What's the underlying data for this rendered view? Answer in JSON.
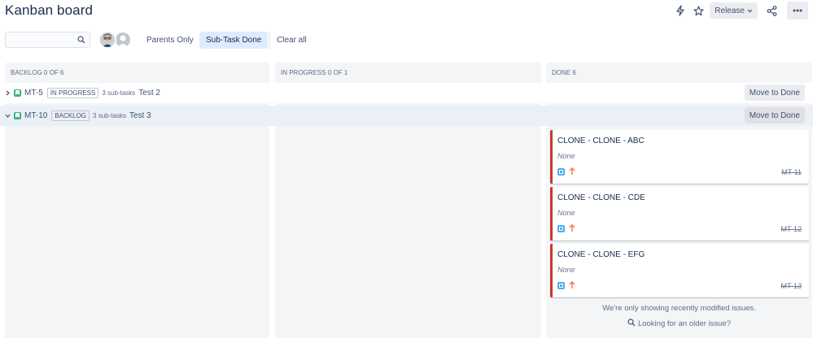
{
  "header": {
    "title": "Kanban board",
    "release_label": "Release",
    "icons": [
      "lightning-icon",
      "star-icon",
      "chevron-down-icon",
      "share-icon",
      "more-icon"
    ]
  },
  "filters": {
    "search_placeholder": "",
    "parents_only": "Parents Only",
    "subtask_done": "Sub-Task Done",
    "clear_all": "Clear all"
  },
  "columns": [
    {
      "name": "BACKLOG",
      "count": "0 of 6"
    },
    {
      "name": "IN PROGRESS",
      "count": "0 of 1"
    },
    {
      "name": "DONE",
      "count": "6"
    }
  ],
  "swimlanes": [
    {
      "key": "MT-5",
      "status": "IN PROGRESS",
      "subtasks": "3 sub-tasks",
      "summary": "Test 2",
      "action": "Move to Done"
    },
    {
      "key": "MT-10",
      "status": "BACKLOG",
      "subtasks": "3 sub-tasks",
      "summary": "Test 3",
      "action": "Move to Done"
    }
  ],
  "cards": [
    {
      "title": "CLONE - CLONE - ABC",
      "assignee": "None",
      "key": "MT-11"
    },
    {
      "title": "CLONE - CLONE - CDE",
      "assignee": "None",
      "key": "MT-12"
    },
    {
      "title": "CLONE - CLONE - EFG",
      "assignee": "None",
      "key": "MT-13"
    }
  ],
  "notice": {
    "line1": "We're only showing recently modified issues.",
    "line2": "Looking for an older issue?"
  },
  "colors": {
    "accent": "#deebff",
    "card_border": "#c9372c",
    "priority": "#ff7452",
    "story": "#36b37e",
    "subtask": "#4bade8"
  }
}
